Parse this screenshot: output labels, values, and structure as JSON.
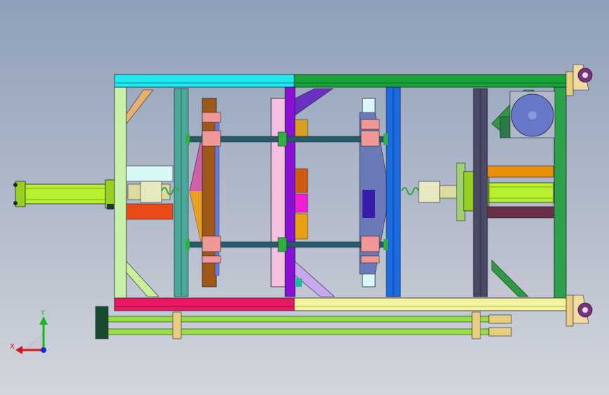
{
  "view": {
    "type": "cad-top-view",
    "background_top": "#8ea0ba",
    "background_bottom": "#d2d6dd"
  },
  "triad": {
    "x_label": "X",
    "y_label": "Y",
    "x_color": "#e0101a",
    "y_color": "#18b818",
    "z_color": "#1a2ad8"
  },
  "parts": [
    {
      "name": "frame-side-left",
      "color": "#c8f0a8"
    },
    {
      "name": "frame-side-right",
      "color": "#2ea24a"
    },
    {
      "name": "rail-top-left",
      "color": "#22e8f0"
    },
    {
      "name": "rail-top-right",
      "color": "#1aa23a"
    },
    {
      "name": "rail-bottom-left",
      "color": "#e81860"
    },
    {
      "name": "rail-bottom-right",
      "color": "#f4f4a0"
    },
    {
      "name": "cylinder-left",
      "color": "#b8f030"
    },
    {
      "name": "cylinder-right",
      "color": "#b8f030"
    },
    {
      "name": "bracket-orange-red",
      "color": "#e84a18"
    },
    {
      "name": "bracket-light-cyan",
      "color": "#d8f8f8"
    },
    {
      "name": "post-teal",
      "color": "#4aa898"
    },
    {
      "name": "platen-wood",
      "color": "#a05818"
    },
    {
      "name": "plate-pink",
      "color": "#f4c0e0"
    },
    {
      "name": "column-violet",
      "color": "#8a10d8"
    },
    {
      "name": "beam-purple",
      "color": "#6a30c0"
    },
    {
      "name": "column-blue",
      "color": "#1a6ae0"
    },
    {
      "name": "column-slate",
      "color": "#4a4a68"
    },
    {
      "name": "motor-blue",
      "color": "#6878c8"
    },
    {
      "name": "bar-orange",
      "color": "#e8900a"
    },
    {
      "name": "bar-maroon",
      "color": "#6a3048"
    },
    {
      "name": "tie-rod",
      "color": "#2a5a6a"
    },
    {
      "name": "clamp-pink",
      "color": "#f09898"
    },
    {
      "name": "caster-wheel",
      "color": "#7a3080"
    },
    {
      "name": "lower-rod",
      "color": "#98e040"
    },
    {
      "name": "fitting-tan",
      "color": "#e8cc80"
    }
  ]
}
